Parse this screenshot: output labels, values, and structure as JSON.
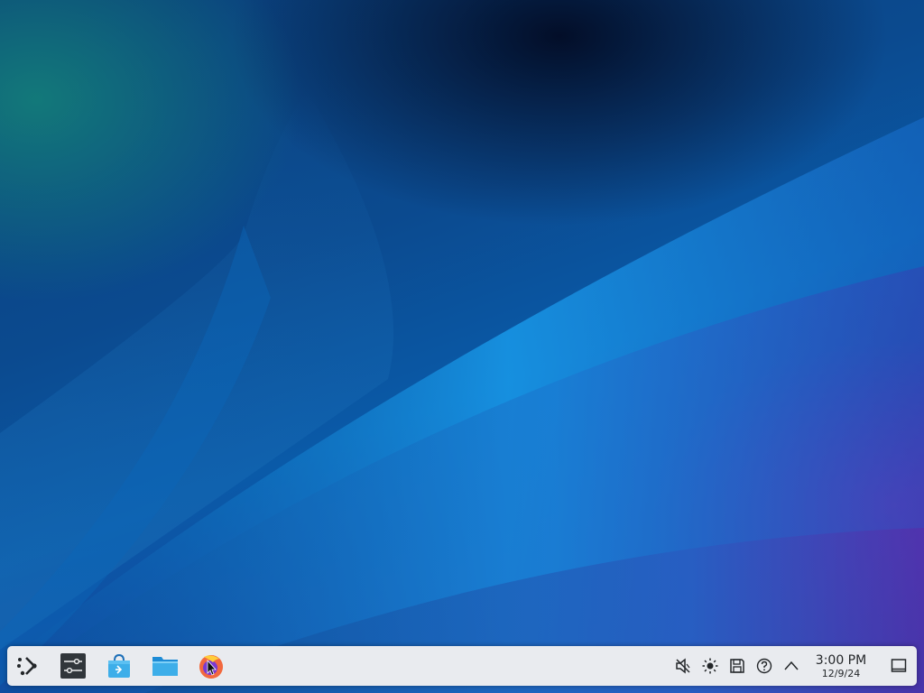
{
  "desktop": {
    "wallpaper_name": "kde-plasma-default-wallpaper"
  },
  "panel": {
    "launcher": {
      "icon": "plasma-launcher-icon"
    },
    "tasks": [
      {
        "name": "system-settings",
        "icon": "settings-sliders-icon"
      },
      {
        "name": "discover",
        "icon": "shopping-bag-icon"
      },
      {
        "name": "dolphin-file-manager",
        "icon": "folder-icon"
      },
      {
        "name": "firefox",
        "icon": "firefox-icon"
      }
    ],
    "tray": [
      {
        "name": "volume-muted",
        "icon": "speaker-muted-icon"
      },
      {
        "name": "brightness",
        "icon": "sun-icon"
      },
      {
        "name": "disks-devices",
        "icon": "floppy-disk-icon"
      },
      {
        "name": "help",
        "icon": "help-circle-icon"
      },
      {
        "name": "show-hidden-icons",
        "icon": "chevron-up-icon"
      }
    ],
    "clock": {
      "time": "3:00 PM",
      "date": "12/9/24"
    },
    "show_desktop": {
      "icon": "show-desktop-icon"
    }
  },
  "colors": {
    "panel_bg": "#e9ebef",
    "icon_dark": "#232629",
    "accent_blue": "#3daee9"
  }
}
